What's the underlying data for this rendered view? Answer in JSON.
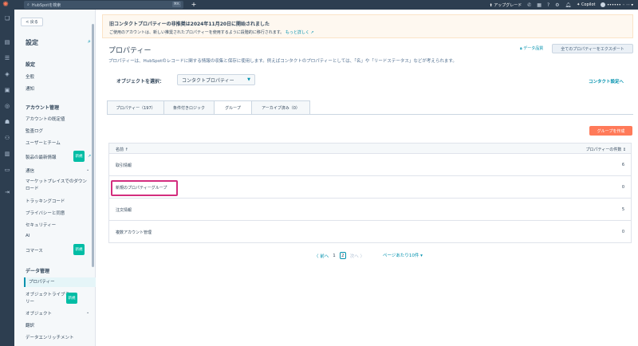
{
  "topbar": {
    "search_placeholder": "HubSpotを検索",
    "search_shortcut": "⌘K",
    "upgrade_label": "アップグレード",
    "copilot_label": "Copilot",
    "account_label": "•••••• ·· ···",
    "brand_color": "#ff7a59"
  },
  "sidebar": {
    "back_label": "< 戻る",
    "title": "設定",
    "sections": {
      "settings": "設定",
      "account": "アカウント管理",
      "data": "データ管理"
    },
    "items": {
      "general": "全般",
      "notifications": "通知",
      "account_defaults": "アカウントの既定値",
      "audit_log": "監査ログ",
      "users_teams": "ユーザーとチーム",
      "product_updates": "製品の最新情報",
      "communications": "通信",
      "marketplace_downloads": "マーケットプレイスでのダウンロード",
      "tracking_code": "トラッキングコード",
      "privacy_consent": "プライバシーと同意",
      "security": "セキュリティー",
      "ai": "AI",
      "commerce": "コマース",
      "properties": "プロパティー",
      "object_library": "オブジェクトライブラリー",
      "objects": "オブジェクト",
      "translation": "翻訳",
      "data_enrichment": "データエンリッチメント"
    },
    "badge_new": "新規"
  },
  "banner": {
    "title": "旧コンタクトプロパティーの非推奨は2024年11月20日に開始されました",
    "message": "ご使用のアカウントは、新しい推奨されたプロパティーを使用するように段階的に移行されます。",
    "link": "もっと詳しく"
  },
  "main": {
    "title": "プロパティー",
    "audit_label": "データ品質",
    "export_label": "全てのプロパティーをエクスポート",
    "description": "プロパティーは、HubSpotのレコードに関する情報の収集と保存に使用します。例えばコンタクトのプロパティーとしては、「名」や「リードステータス」などが考えられます。",
    "object_label": "オブジェクトを選択：",
    "object_value": "コンタクトプロパティー",
    "contact_settings_link": "コンタクト設定へ",
    "tabs": [
      {
        "label": "プロパティー（197）"
      },
      {
        "label": "条件付きロジック"
      },
      {
        "label": "グループ"
      },
      {
        "label": "アーカイブ済み（0）"
      }
    ],
    "create_group_label": "グループを作成"
  },
  "table": {
    "col_name": "名前 ↑",
    "col_count": "プロパティーの件数 ↕",
    "rows": [
      {
        "name": "取引情報",
        "count": "6"
      },
      {
        "name": "新規のプロパティーグループ",
        "count": "0"
      },
      {
        "name": "注文情報",
        "count": "5"
      },
      {
        "name": "複数アカウント管理",
        "count": "0"
      }
    ]
  },
  "pager": {
    "prev": "前へ",
    "page1": "1",
    "page2": "2",
    "next": "次へ",
    "per_page": "ページあたり10件"
  }
}
